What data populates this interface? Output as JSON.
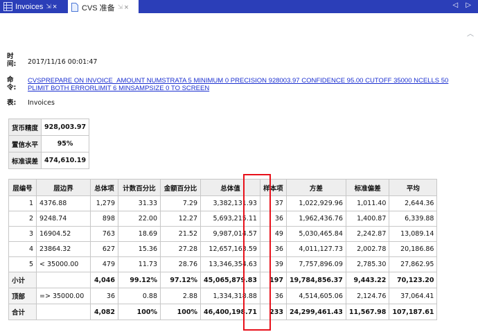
{
  "tabs": [
    {
      "label": "Invoices",
      "icon": "table-icon",
      "pin": "⇲",
      "close": "×"
    },
    {
      "label": "CVS 准备",
      "icon": "document-icon",
      "pin": "⇲",
      "close": "×"
    }
  ],
  "tab_scroll": "◁ ▷",
  "meta": {
    "time_key": "时间:",
    "time_val": "2017/11/16 00:01:47",
    "cmd_key": "命令:",
    "cmd_val": "CVSPREPARE ON INVOICE_AMOUNT NUMSTRATA 5 MINIMUM 0 PRECISION 928003.97 CONFIDENCE 95.00 CUTOFF 35000 NCELLS 50 PLIMIT BOTH ERRORLIMIT 6 MINSAMPSIZE 0 TO SCREEN",
    "table_key": "表:",
    "table_val": "Invoices"
  },
  "summary": [
    {
      "label": "货币精度",
      "value": "928,003.97"
    },
    {
      "label": "置信水平",
      "value": "95%"
    },
    {
      "label": "标准误差",
      "value": "474,610.19"
    }
  ],
  "table": {
    "headers": [
      "层编号",
      "层边界",
      "总体项",
      "计数百分比",
      "金额百分比",
      "总体值",
      "样本项",
      "方差",
      "标准偏差",
      "平均"
    ],
    "rows": [
      [
        "1",
        "4376.88",
        "1,279",
        "31.33",
        "7.29",
        "3,382,131.93",
        "37",
        "1,022,929.96",
        "1,011.40",
        "2,644.36"
      ],
      [
        "2",
        "9248.74",
        "898",
        "22.00",
        "12.27",
        "5,693,215.11",
        "36",
        "1,962,436.76",
        "1,400.87",
        "6,339.88"
      ],
      [
        "3",
        "16904.52",
        "763",
        "18.69",
        "21.52",
        "9,987,014.57",
        "49",
        "5,030,465.84",
        "2,242.87",
        "13,089.14"
      ],
      [
        "4",
        "23864.32",
        "627",
        "15.36",
        "27.28",
        "12,657,163.59",
        "36",
        "4,011,127.73",
        "2,002.78",
        "20,186.86"
      ],
      [
        "5",
        "< 35000.00",
        "479",
        "11.73",
        "28.76",
        "13,346,354.63",
        "39",
        "7,757,896.09",
        "2,785.30",
        "27,862.95"
      ]
    ],
    "subtotal": [
      "小计",
      "",
      "4,046",
      "99.12%",
      "97.12%",
      "45,065,879.83",
      "197",
      "19,784,856.37",
      "9,443.22",
      "70,123.20"
    ],
    "top": [
      "顶部",
      "=> 35000.00",
      "36",
      "0.88",
      "2.88",
      "1,334,318.88",
      "36",
      "4,514,605.06",
      "2,124.76",
      "37,064.41"
    ],
    "total": [
      "合计",
      "",
      "4,082",
      "100%",
      "100%",
      "46,400,198.71",
      "233",
      "24,299,461.43",
      "11,567.98",
      "107,187.61"
    ]
  },
  "colors": {
    "tabbar": "#2b3eb8",
    "link": "#1a2fd0",
    "highlight": "#e8101a"
  }
}
